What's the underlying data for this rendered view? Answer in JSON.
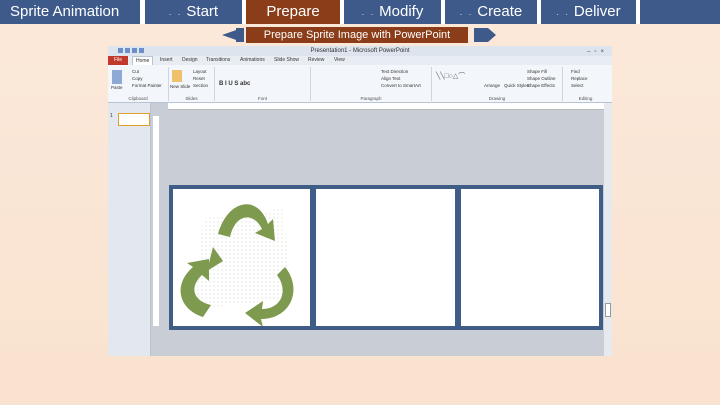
{
  "nav": {
    "title": "Sprite Animation",
    "tabs": [
      {
        "label": "Start"
      },
      {
        "label": "Prepare"
      },
      {
        "label": "Modify"
      },
      {
        "label": "Create"
      },
      {
        "label": "Deliver"
      }
    ]
  },
  "subnav": {
    "label": "Prepare Sprite Image with PowerPoint"
  },
  "ppt": {
    "window_title": "Presentation1 - Microsoft PowerPoint",
    "ribbon_tabs": [
      "File",
      "Home",
      "Insert",
      "Design",
      "Transitions",
      "Animations",
      "Slide Show",
      "Review",
      "View"
    ],
    "groups": [
      "Clipboard",
      "Slides",
      "Font",
      "Paragraph",
      "Drawing",
      "Editing"
    ],
    "clipboard": {
      "paste": "Paste",
      "cut": "Cut",
      "copy": "Copy",
      "format_painter": "Format Painter"
    },
    "slides": {
      "new_slide": "New Slide",
      "layout": "Layout",
      "reset": "Reset",
      "section": "Section"
    },
    "paragraph": {
      "text_direction": "Text Direction",
      "align_text": "Align Text",
      "smartart": "Convert to SmartArt"
    },
    "drawing": {
      "arrange": "Arrange",
      "quick_styles": "Quick Styles",
      "shape_fill": "Shape Fill",
      "shape_outline": "Shape Outline",
      "shape_effects": "Shape Effects"
    },
    "editing": {
      "find": "Find",
      "replace": "Replace",
      "select": "Select"
    },
    "thumb_number": "1"
  },
  "colors": {
    "tab_blue": "#3d5a8a",
    "tab_active": "#8a3d18",
    "recycle_green": "#7e9a4e",
    "slide_border": "#3f5d86"
  }
}
